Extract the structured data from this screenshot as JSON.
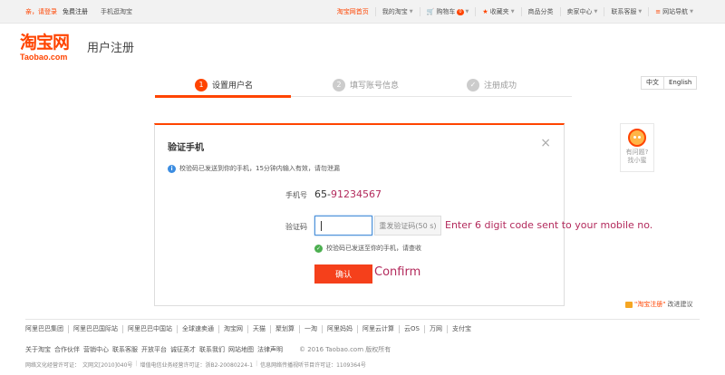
{
  "topbar": {
    "greeting": "亲，请登录",
    "register": "免费注册",
    "mobile": "手机逛淘宝",
    "home": "淘宝网首页",
    "my_taobao": "我的淘宝",
    "cart": "购物车",
    "cart_count": "0",
    "favorites": "收藏夹",
    "categories": "商品分类",
    "seller": "卖家中心",
    "service": "联系客服",
    "site_nav": "网站导航"
  },
  "logo": {
    "cn": "淘宝网",
    "en": "Taobao.com"
  },
  "page_title": "用户注册",
  "steps": [
    {
      "num": "1",
      "label": "设置用户名"
    },
    {
      "num": "2",
      "label": "填写账号信息"
    },
    {
      "num": "✓",
      "label": "注册成功"
    }
  ],
  "lang": {
    "zh": "中文",
    "en": "English"
  },
  "help": {
    "line1": "有问题?",
    "line2": "找小蜜"
  },
  "dialog": {
    "title": "验证手机",
    "close": "×",
    "info": "校验码已发送到你的手机，15分钟内输入有效，请勿泄漏",
    "phone_label": "手机号",
    "phone_prefix": "65-",
    "phone_number": "91234567",
    "code_label": "验证码",
    "code_value": "",
    "resend": "重发验证码(50 s)",
    "code_note": "Enter 6 digit code sent to your mobile no.",
    "sent_ok": "校验码已发送至你的手机，请查收",
    "confirm": "确认",
    "confirm_note": "Confirm"
  },
  "feedback": {
    "q": "\"淘宝注册\"",
    "text": "改进建议"
  },
  "footer": {
    "links": [
      "阿里巴巴集团",
      "阿里巴巴国际站",
      "阿里巴巴中国站",
      "全球速卖通",
      "淘宝网",
      "天猫",
      "聚划算",
      "一淘",
      "阿里妈妈",
      "阿里云计算",
      "云OS",
      "万网",
      "支付宝"
    ],
    "sub": [
      "关于淘宝",
      "合作伙伴",
      "营销中心",
      "联系客服",
      "开放平台",
      "诚征英才",
      "联系我们",
      "网站地图",
      "法律声明"
    ],
    "copyright": "© 2016 Taobao.com 版权所有",
    "lic1": "网络文化经营许可证：",
    "lic1v": "文网文[2010]040号",
    "lic2": "增值电信业务经营许可证：浙B2-20080224-1",
    "lic3": "信息网络传播视听节目许可证：1109364号"
  }
}
